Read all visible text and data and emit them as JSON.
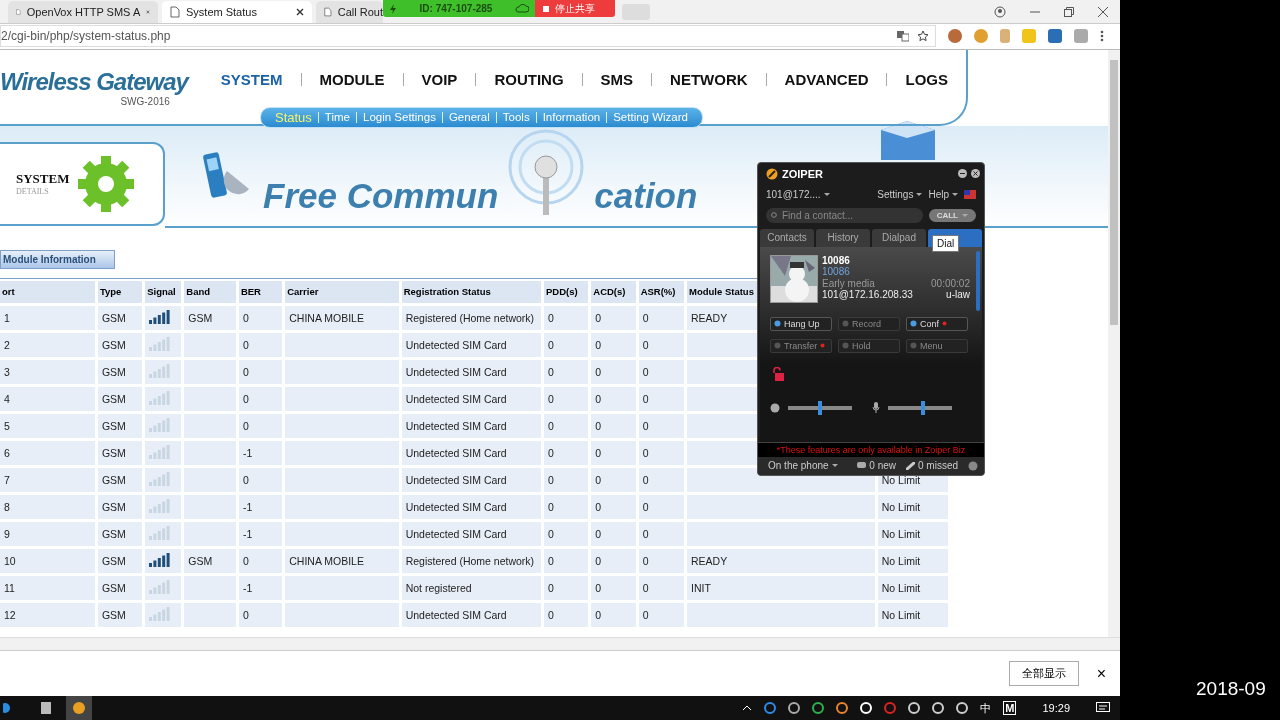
{
  "browser": {
    "tabs": [
      {
        "title": "OpenVox HTTP SMS A",
        "selected": false
      },
      {
        "title": "System Status",
        "selected": true
      },
      {
        "title": "Call Rout",
        "selected": false
      }
    ],
    "address": "2/cgi-bin/php/system-status.php"
  },
  "screen_share": {
    "id": "ID: 747-107-285",
    "stop": "停止共享"
  },
  "header": {
    "logo": "Wireless Gateway",
    "model": "SWG-2016",
    "nav": [
      {
        "label": "SYSTEM",
        "selected": true
      },
      {
        "label": "MODULE",
        "selected": false
      },
      {
        "label": "VOIP",
        "selected": false
      },
      {
        "label": "ROUTING",
        "selected": false
      },
      {
        "label": "SMS",
        "selected": false
      },
      {
        "label": "NETWORK",
        "selected": false
      },
      {
        "label": "ADVANCED",
        "selected": false
      },
      {
        "label": "LOGS",
        "selected": false
      }
    ],
    "subnav": [
      {
        "label": "Status",
        "selected": true
      },
      {
        "label": "Time",
        "selected": false
      },
      {
        "label": "Login Settings",
        "selected": false
      },
      {
        "label": "General",
        "selected": false
      },
      {
        "label": "Tools",
        "selected": false
      },
      {
        "label": "Information",
        "selected": false
      },
      {
        "label": "Setting Wizard",
        "selected": false
      }
    ]
  },
  "banner": {
    "section": "SYSTEM",
    "section_sub": "DETAILS",
    "slogan_start": "Free Commun",
    "slogan_end": "cation"
  },
  "module_tab": "Module Information",
  "table": {
    "columns": [
      "ort",
      "Type",
      "Signal",
      "Band",
      "BER",
      "Carrier",
      "Registration Status",
      "PDD(s)",
      "ACD(s)",
      "ASR(%)",
      "Module Status"
    ],
    "rows": [
      {
        "port": "1",
        "type": "GSM",
        "signal_on": true,
        "band": "GSM",
        "ber": "0",
        "carrier": "CHINA MOBILE",
        "registration": "Registered (Home network)",
        "pdd": "0",
        "acd": "0",
        "asr": "0",
        "module_status": "READY"
      },
      {
        "port": "2",
        "type": "GSM",
        "signal_on": false,
        "ber": "0",
        "registration": "Undetected SIM Card",
        "pdd": "0",
        "acd": "0",
        "asr": "0"
      },
      {
        "port": "3",
        "type": "GSM",
        "signal_on": false,
        "ber": "0",
        "registration": "Undetected SIM Card",
        "pdd": "0",
        "acd": "0",
        "asr": "0"
      },
      {
        "port": "4",
        "type": "GSM",
        "signal_on": false,
        "ber": "0",
        "registration": "Undetected SIM Card",
        "pdd": "0",
        "acd": "0",
        "asr": "0"
      },
      {
        "port": "5",
        "type": "GSM",
        "signal_on": false,
        "ber": "0",
        "registration": "Undetected SIM Card",
        "pdd": "0",
        "acd": "0",
        "asr": "0"
      },
      {
        "port": "6",
        "type": "GSM",
        "signal_on": false,
        "ber": "-1",
        "registration": "Undetected SIM Card",
        "pdd": "0",
        "acd": "0",
        "asr": "0"
      },
      {
        "port": "7",
        "type": "GSM",
        "signal_on": false,
        "ber": "0",
        "registration": "Undetected SIM Card",
        "pdd": "0",
        "acd": "0",
        "asr": "0",
        "column_12": "No Limit"
      },
      {
        "port": "8",
        "type": "GSM",
        "signal_on": false,
        "ber": "-1",
        "registration": "Undetected SIM Card",
        "pdd": "0",
        "acd": "0",
        "asr": "0",
        "column_12": "No Limit"
      },
      {
        "port": "9",
        "type": "GSM",
        "signal_on": false,
        "ber": "-1",
        "registration": "Undetected SIM Card",
        "pdd": "0",
        "acd": "0",
        "asr": "0",
        "column_12": "No Limit"
      },
      {
        "port": "10",
        "type": "GSM",
        "signal_on": true,
        "band": "GSM",
        "ber": "0",
        "carrier": "CHINA MOBILE",
        "registration": "Registered (Home network)",
        "pdd": "0",
        "acd": "0",
        "asr": "0",
        "module_status": "READY",
        "column_12": "No Limit"
      },
      {
        "port": "11",
        "type": "GSM",
        "signal_on": false,
        "ber": "-1",
        "registration": "Not registered",
        "pdd": "0",
        "acd": "0",
        "asr": "0",
        "module_status": "INIT",
        "column_12": "No Limit"
      },
      {
        "port": "12",
        "type": "GSM",
        "signal_on": false,
        "ber": "0",
        "registration": "Undetected SIM Card",
        "pdd": "0",
        "acd": "0",
        "asr": "0",
        "column_12": "No Limit"
      }
    ]
  },
  "zoiper": {
    "title": "ZOIPER",
    "account": "101@172....",
    "menus": [
      "Settings",
      "Help"
    ],
    "search_placeholder": "Find a contact...",
    "call_button": "CALL",
    "tabs": [
      {
        "label": "Contacts",
        "selected": false
      },
      {
        "label": "History",
        "selected": false
      },
      {
        "label": "Dialpad",
        "selected": false
      },
      {
        "selected": true
      }
    ],
    "tooltip": "Dial",
    "call": {
      "name": "10086",
      "number": "10086",
      "state": "Early media",
      "duration": "00:00:02",
      "account": "101@172.16.208.33",
      "codec": "u-law"
    },
    "actions": [
      {
        "label": "Hang Up",
        "disabled": false,
        "biz_only": false
      },
      {
        "label": "Record",
        "disabled": true,
        "biz_only": false
      },
      {
        "label": "Conf",
        "disabled": false,
        "biz_only": true
      },
      {
        "label": "Transfer",
        "disabled": true,
        "biz_only": true
      },
      {
        "label": "Hold",
        "disabled": true,
        "biz_only": false
      },
      {
        "label": "Menu",
        "disabled": true,
        "biz_only": false
      }
    ],
    "speaker": {
      "level": 0.5
    },
    "microphone": {
      "level": 0.55
    },
    "note": "*These features are only available in Zoiper Biz",
    "status": "On the phone",
    "new": "0 new",
    "missed": "0 missed"
  },
  "download_bar": {
    "show_all": "全部显示",
    "close": "×"
  },
  "taskbar": {
    "ime": "中",
    "m": "M",
    "clock": "19:29"
  },
  "overlay_date": "2018-09"
}
